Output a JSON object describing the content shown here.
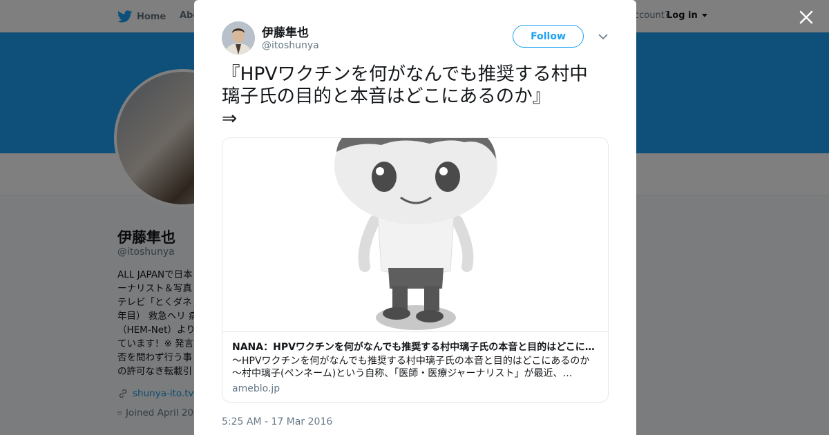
{
  "nav": {
    "home_label": "Home",
    "about_label": "Abo",
    "account_text": "ccount?",
    "login_label": "Log in"
  },
  "colors": {
    "brand_blue": "#1da1f2",
    "banner_blue": "#1da1f2",
    "text_primary": "#14171a",
    "text_secondary": "#657786"
  },
  "profile": {
    "name": "伊藤隼也",
    "handle": "@itoshunya",
    "bio_lines": [
      "ALL JAPANで日本",
      "ーナリスト＆写真",
      "テレビ「とくダネ",
      "年目） 救急ヘリ 病",
      "（HEM-Net）より",
      "ています！※ 発言",
      "否を問わず行う事",
      "の許可なき転載引"
    ],
    "website": "shunya-ito.tv",
    "joined": "Joined April 20"
  },
  "tweet": {
    "author_name": "伊藤隼也",
    "author_handle": "@itoshunya",
    "follow_label": "Follow",
    "text_lines": [
      "『HPVワクチンを何がなんでも推奨する村中",
      "璃子氏の目的と本音はどこにあるのか』",
      "⇒"
    ],
    "card": {
      "title": "NANA：HPVワクチンを何がなんでも推奨する村中璃子氏の本音と目的はどこにあ…",
      "description_lines": [
        "～HPVワクチンを何がなんでも推奨する村中璃子氏の本音と目的はどこにあるのか",
        "～村中璃子(ペンネーム)という自称、「医師・医療ジャーナリスト」が最近、…"
      ],
      "domain": "ameblo.jp"
    },
    "timestamp": "5:25 AM - 17 Mar 2016"
  },
  "icons": {
    "bird": "twitter-bird-icon",
    "close": "close-icon",
    "caret": "chevron-down-icon",
    "link": "link-icon",
    "calendar": "calendar-icon"
  }
}
